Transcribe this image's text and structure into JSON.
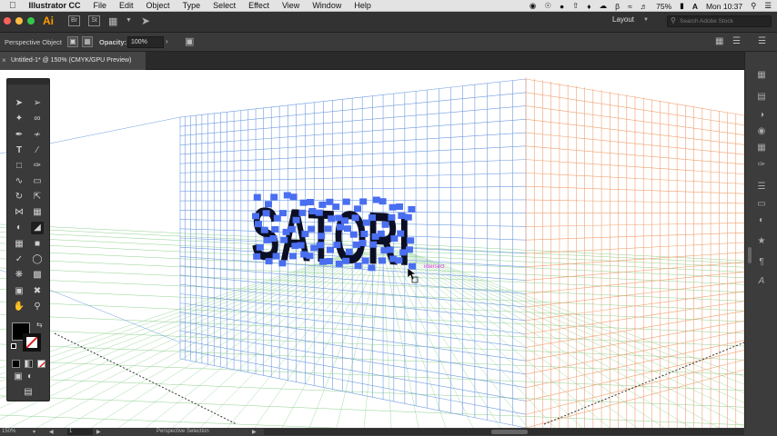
{
  "menubar": {
    "apple": "",
    "app_name": "Illustrator CC",
    "items": [
      "File",
      "Edit",
      "Object",
      "Type",
      "Select",
      "Effect",
      "View",
      "Window",
      "Help"
    ],
    "battery": "75%",
    "clock": "Mon 10:37"
  },
  "appbar": {
    "logo": "Ai",
    "bridge": "Br",
    "stock": "St",
    "workspace": "Layout",
    "search_placeholder": "Search Adobe Stock"
  },
  "control_bar": {
    "selection_label": "Perspective Object",
    "opacity_label": "Opacity:",
    "opacity_value": "100%"
  },
  "document_tab": {
    "title": "Untitled-1* @ 150% (CMYK/GPU Preview)"
  },
  "canvas": {
    "artwork_text": "SATORI",
    "smart_guide_label": "intersect"
  },
  "statusbar": {
    "zoom": "150%",
    "artboard": "1",
    "current_tool": "Perspective Selection"
  },
  "colors": {
    "left_grid": "#6f9be0",
    "right_grid": "#f0a070",
    "ground_grid": "#8fd08f",
    "selection": "#4a6ef0",
    "smart_guide": "#e040e0"
  }
}
